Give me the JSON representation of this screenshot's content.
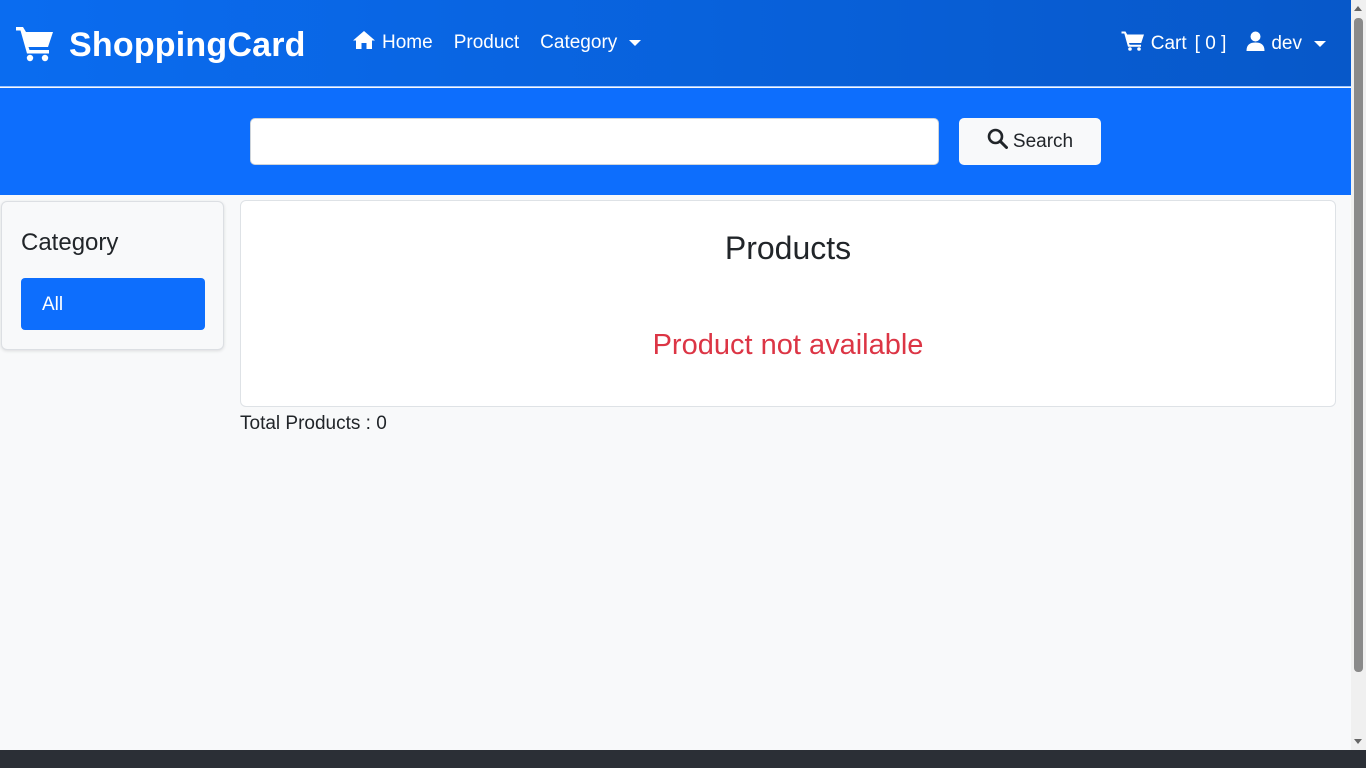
{
  "navbar": {
    "brand": "ShoppingCard",
    "links": {
      "home": "Home",
      "product": "Product",
      "category": "Category"
    },
    "cart_label": "Cart",
    "cart_count": "[ 0 ]",
    "user": "dev"
  },
  "search": {
    "value": "",
    "placeholder": "",
    "button_label": "Search"
  },
  "sidebar": {
    "title": "Category",
    "items": [
      {
        "label": "All",
        "active": true
      }
    ]
  },
  "main": {
    "title": "Products",
    "empty_message": "Product not available",
    "total_label": "Total Products : 0"
  },
  "colors": {
    "primary": "#0d6efd",
    "danger": "#dc3545",
    "background": "#f8f9fa"
  }
}
